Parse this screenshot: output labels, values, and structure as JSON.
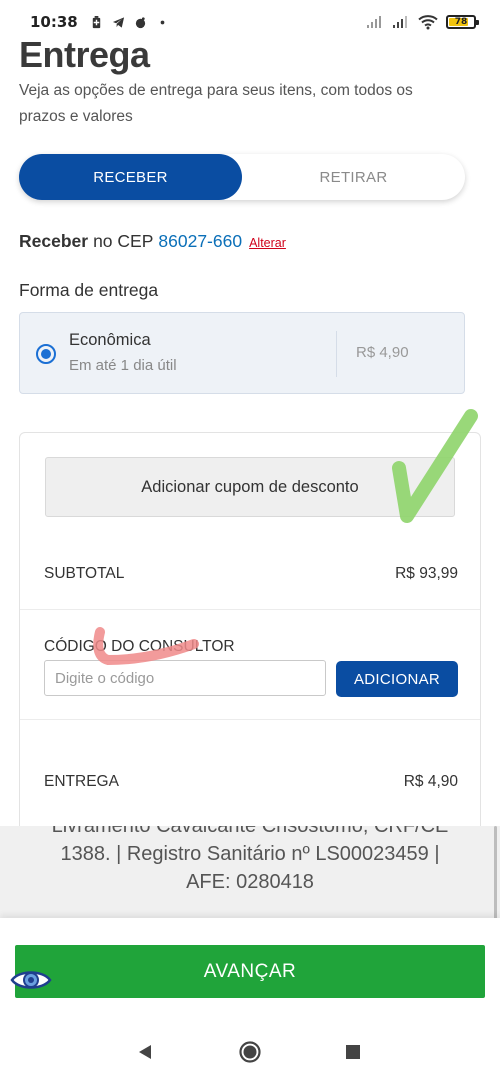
{
  "status_bar": {
    "time": "10:38",
    "battery": "78",
    "battery_color": "#f1c40f"
  },
  "header": {
    "title": "Entrega",
    "subtitle": "Veja as opções de entrega para seus itens, com todos os prazos e valores"
  },
  "delivery_toggle": {
    "receive_label": "RECEBER",
    "pickup_label": "RETIRAR",
    "active": "RECEBER"
  },
  "cep": {
    "prefix_bold": "Receber",
    "middle": "no CEP",
    "code": "86027-660",
    "change_link": "Alterar"
  },
  "shipping": {
    "section_label": "Forma de entrega",
    "option_name": "Econômica",
    "option_eta": "Em até 1 dia útil",
    "option_price": "R$ 4,90",
    "selected": true
  },
  "summary": {
    "coupon_button": "Adicionar cupom de desconto",
    "subtotal_label": "SUBTOTAL",
    "subtotal_value": "R$ 93,99",
    "consultant_label": "CÓDIGO DO CONSULTOR",
    "consultant_placeholder": "Digite o código",
    "consultant_add": "ADICIONAR",
    "delivery_label": "ENTREGA",
    "delivery_value": "R$ 4,90"
  },
  "footer": {
    "legal_line1": "Livramento Cavalcante Crisostomo, CRF/CE",
    "legal_line2": "1388. | Registro Sanitário nº LS00023459 |",
    "legal_line3": "AFE: 0280418",
    "advance_button": "AVANÇAR"
  },
  "colors": {
    "primary_blue": "#0a4da2",
    "advance_green": "#20a43a",
    "link_red": "#d0021b",
    "cep_blue": "#0a6fb8"
  },
  "icons": [
    "battery-plus-icon",
    "telegram-icon",
    "app-icon",
    "dot-icon",
    "signal-icon",
    "wifi-icon",
    "battery-icon",
    "eye-icon",
    "back-icon",
    "home-icon",
    "recents-icon"
  ]
}
